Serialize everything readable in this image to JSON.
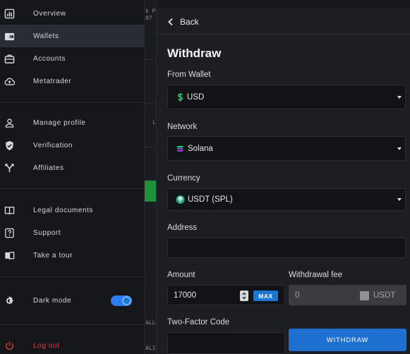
{
  "sidebar": {
    "items": [
      {
        "label": "Overview",
        "icon": "bar-chart-icon"
      },
      {
        "label": "Wallets",
        "icon": "wallet-icon"
      },
      {
        "label": "Accounts",
        "icon": "briefcase-icon"
      },
      {
        "label": "Metatrader",
        "icon": "cloud-upload-icon"
      },
      {
        "label": "Manage profile",
        "icon": "user-icon"
      },
      {
        "label": "Verification",
        "icon": "shield-check-icon"
      },
      {
        "label": "Affiliates",
        "icon": "fork-icon"
      },
      {
        "label": "Legal documents",
        "icon": "book-icon"
      },
      {
        "label": "Support",
        "icon": "help-icon"
      },
      {
        "label": "Take a tour",
        "icon": "open-book-icon"
      },
      {
        "label": "Dark mode",
        "icon": "contrast-icon",
        "toggle_on": true
      },
      {
        "label": "Log out",
        "icon": "power-icon"
      }
    ],
    "active_item": "Wallets"
  },
  "background": {
    "texts": [
      "k P",
      "87",
      "L",
      "ALL",
      "ALI"
    ]
  },
  "withdraw": {
    "back_label": "Back",
    "title": "Withdraw",
    "from_wallet": {
      "label": "From Wallet",
      "value": "USD",
      "icon": "dollar-icon"
    },
    "network": {
      "label": "Network",
      "value": "Solana",
      "icon": "solana-icon"
    },
    "currency": {
      "label": "Currency",
      "value": "USDT (SPL)",
      "icon": "tether-icon"
    },
    "address": {
      "label": "Address",
      "value": ""
    },
    "amount": {
      "label": "Amount",
      "value": "17000",
      "max_label": "MAX"
    },
    "fee": {
      "label": "Withdrawal fee",
      "value": "0",
      "unit": "USDT"
    },
    "two_factor": {
      "label": "Two-Factor Code",
      "value": ""
    },
    "submit_label": "WITHDRAW"
  },
  "colors": {
    "accent": "#1d6fd0",
    "logout": "#e03a3a",
    "dollar_green": "#2ecc71",
    "tether_green": "#26a17b"
  }
}
